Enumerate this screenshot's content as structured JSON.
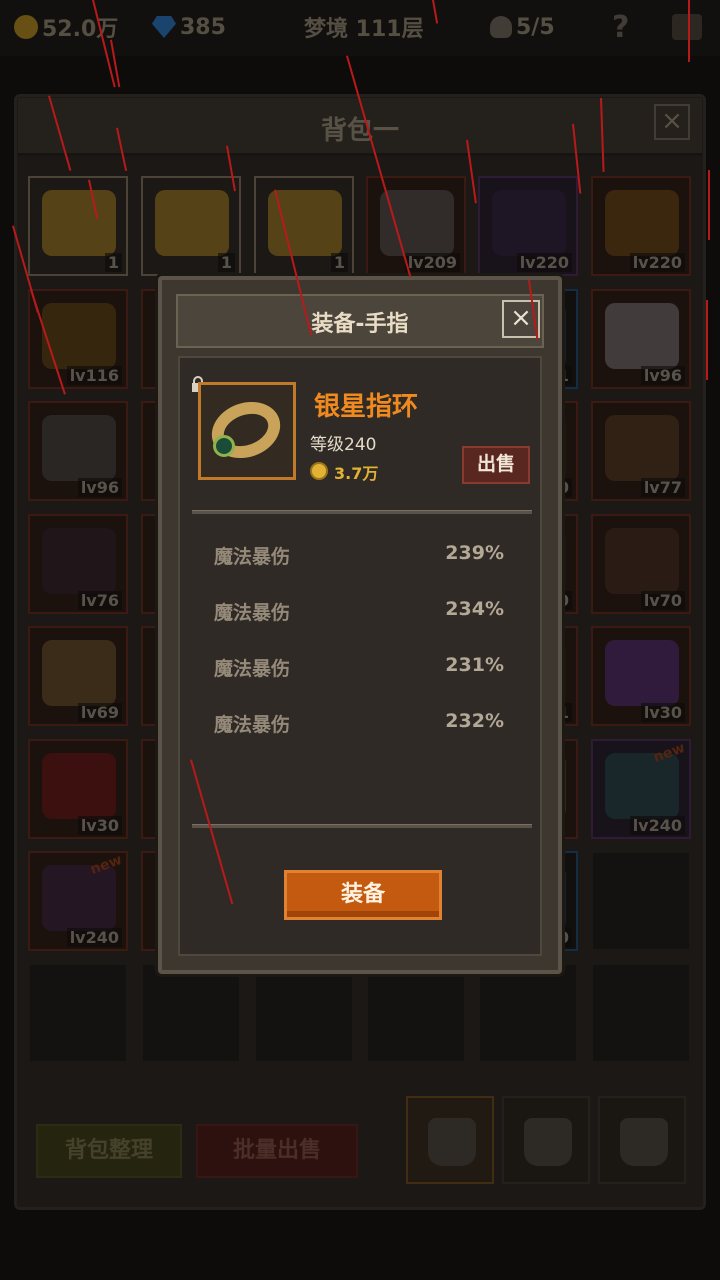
{
  "topbar": {
    "gold": "52.0万",
    "gems": "385",
    "stage": "梦境 111层",
    "skull": "5/5",
    "help": "?"
  },
  "bag": {
    "title": "背包一",
    "close": "×",
    "slots": [
      {
        "lvl": "1"
      },
      {
        "lvl": "1"
      },
      {
        "lvl": "1"
      },
      {
        "lvl": "lv209"
      },
      {
        "lvl": "lv220"
      },
      {
        "lvl": "lv220"
      },
      {
        "lvl": "lv116"
      },
      {
        "lvl": ""
      },
      {
        "lvl": ""
      },
      {
        "lvl": ""
      },
      {
        "lvl": "1"
      },
      {
        "lvl": "lv96"
      },
      {
        "lvl": "lv96"
      },
      {
        "lvl": ""
      },
      {
        "lvl": ""
      },
      {
        "lvl": ""
      },
      {
        "lvl": "0"
      },
      {
        "lvl": "lv77"
      },
      {
        "lvl": "lv76"
      },
      {
        "lvl": ""
      },
      {
        "lvl": ""
      },
      {
        "lvl": ""
      },
      {
        "lvl": "0"
      },
      {
        "lvl": "lv70"
      },
      {
        "lvl": "lv69"
      },
      {
        "lvl": ""
      },
      {
        "lvl": ""
      },
      {
        "lvl": ""
      },
      {
        "lvl": "1"
      },
      {
        "lvl": "lv30"
      },
      {
        "lvl": "lv30"
      },
      {
        "lvl": ""
      },
      {
        "lvl": ""
      },
      {
        "lvl": ""
      },
      {
        "lvl": ""
      },
      {
        "lvl": "lv240"
      },
      {
        "lvl": "lv240"
      },
      {
        "lvl": ""
      },
      {
        "lvl": ""
      },
      {
        "lvl": ""
      },
      {
        "lvl": "0"
      },
      {
        "lvl": ""
      }
    ],
    "new_badge": "new",
    "sort_button": "背包整理",
    "bulk_sell_button": "批量出售"
  },
  "modal": {
    "title": "装备-手指",
    "close": "×",
    "item": {
      "name": "银星指环",
      "level": "等级240",
      "price": "3.7万",
      "sell_button": "出售"
    },
    "stats": [
      {
        "name": "魔法暴伤",
        "value": "239%"
      },
      {
        "name": "魔法暴伤",
        "value": "234%"
      },
      {
        "name": "魔法暴伤",
        "value": "231%"
      },
      {
        "name": "魔法暴伤",
        "value": "232%"
      }
    ],
    "equip_button": "装备"
  },
  "colors": {
    "item_name": "#f08a1e",
    "equip_button": "#c45a10",
    "rain": "#b81a1a"
  }
}
